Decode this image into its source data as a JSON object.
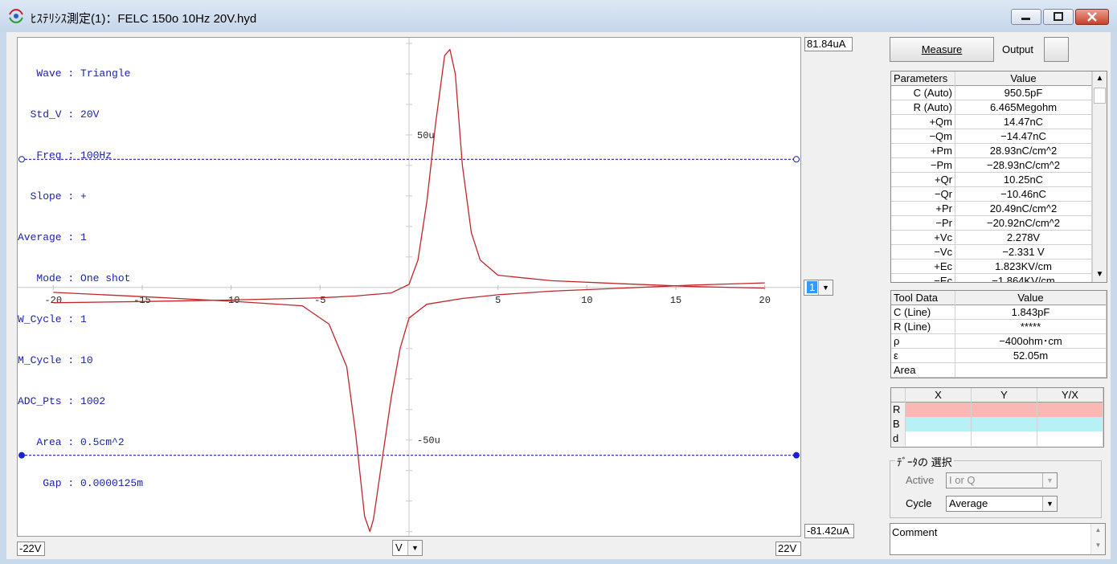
{
  "window": {
    "title": "ﾋｽﾃﾘｼｽ測定(1)：FELC 150o 10Hz 20V.hyd"
  },
  "plot": {
    "info_lines": [
      "   Wave : Triangle",
      "  Std_V : 20V",
      "   Freq : 100Hz",
      "  Slope : +",
      "Average : 1",
      "   Mode : One shot",
      "W_Cycle : 1",
      "M_Cycle : 10",
      "ADC_Pts : 1002",
      "   Area : 0.5cm^2",
      "    Gap : 0.0000125m"
    ],
    "y_top_label": "81.84uA",
    "y_bottom_label": "-81.42uA",
    "x_left_label": "-22V",
    "x_right_label": "22V",
    "x_unit_select": "V",
    "channel_select": "1"
  },
  "chart_data": {
    "type": "line",
    "xlim": [
      -22,
      22
    ],
    "ylim": [
      -81.42,
      81.84
    ],
    "x_ticks": [
      "-20",
      "-15",
      "-10",
      "-5",
      "5",
      "10",
      "15",
      "20"
    ],
    "y_tick_labels": [
      "50u",
      "-50u"
    ],
    "cursor_upper_y": 42,
    "cursor_lower_y": -55,
    "color": "#c0262a",
    "series": [
      {
        "values": [
          [
            -20,
            -5
          ],
          [
            -15,
            -4.6
          ],
          [
            -10,
            -4.1
          ],
          [
            -5,
            -3.4
          ],
          [
            -3,
            -2.8
          ],
          [
            -1,
            -1.8
          ],
          [
            0,
            1
          ],
          [
            0.5,
            9
          ],
          [
            1,
            28
          ],
          [
            1.5,
            54
          ],
          [
            2,
            76
          ],
          [
            2.3,
            78
          ],
          [
            2.6,
            70
          ],
          [
            3,
            40
          ],
          [
            3.5,
            18
          ],
          [
            4,
            9
          ],
          [
            5,
            4
          ],
          [
            8,
            2.2
          ],
          [
            12,
            1.2
          ],
          [
            16,
            0.3
          ],
          [
            20,
            -0.2
          ]
        ]
      },
      {
        "values": [
          [
            20,
            1.5
          ],
          [
            16,
            0.8
          ],
          [
            12,
            -0.2
          ],
          [
            8,
            -1.2
          ],
          [
            5,
            -2.4
          ],
          [
            3,
            -3.6
          ],
          [
            1,
            -5.5
          ],
          [
            0,
            -10
          ],
          [
            -0.5,
            -20
          ],
          [
            -1,
            -36
          ],
          [
            -1.5,
            -56
          ],
          [
            -2,
            -76
          ],
          [
            -2.2,
            -80
          ],
          [
            -2.5,
            -75
          ],
          [
            -3,
            -48
          ],
          [
            -3.5,
            -26
          ],
          [
            -4.5,
            -12
          ],
          [
            -6,
            -6
          ],
          [
            -10,
            -4.5
          ],
          [
            -15,
            -3
          ],
          [
            -20,
            -1.6
          ]
        ]
      }
    ]
  },
  "controls": {
    "measure_label": "Measure",
    "output_label": "Output"
  },
  "params": {
    "headers": [
      "Parameters",
      "Value"
    ],
    "rows": [
      [
        "C (Auto)",
        "950.5pF"
      ],
      [
        "R (Auto)",
        "6.465Megohm"
      ],
      [
        "+Qm",
        "14.47nC"
      ],
      [
        "−Qm",
        "−14.47nC"
      ],
      [
        "+Pm",
        "28.93nC/cm^2"
      ],
      [
        "−Pm",
        "−28.93nC/cm^2"
      ],
      [
        "+Qr",
        "10.25nC"
      ],
      [
        "−Qr",
        "−10.46nC"
      ],
      [
        "+Pr",
        "20.49nC/cm^2"
      ],
      [
        "−Pr",
        "−20.92nC/cm^2"
      ],
      [
        "+Vc",
        "2.278V"
      ],
      [
        "−Vc",
        "−2.331 V"
      ],
      [
        "+Ec",
        "1.823KV/cm"
      ],
      [
        "−Ec",
        "−1.864KV/cm"
      ]
    ]
  },
  "tool": {
    "headers": [
      "Tool Data",
      "Value"
    ],
    "rows": [
      [
        "C (Line)",
        "1.843pF"
      ],
      [
        "R (Line)",
        "*****"
      ],
      [
        "ρ",
        "−400ohm･cm"
      ],
      [
        "ε",
        "52.05m"
      ],
      [
        "Area",
        ""
      ]
    ]
  },
  "xy": {
    "headers": [
      "",
      "X",
      "Y",
      "Y/X"
    ],
    "rows": [
      {
        "label": "R",
        "color": "#fbb7b4"
      },
      {
        "label": "B",
        "color": "#b7f1f6"
      },
      {
        "label": "d",
        "color": "#ffffff"
      }
    ]
  },
  "data_select": {
    "legend": "ﾃﾞｰﾀの 選択",
    "active_label": "Active",
    "active_value": "I or Q",
    "cycle_label": "Cycle",
    "cycle_value": "Average"
  },
  "comment": {
    "placeholder": "Comment"
  }
}
